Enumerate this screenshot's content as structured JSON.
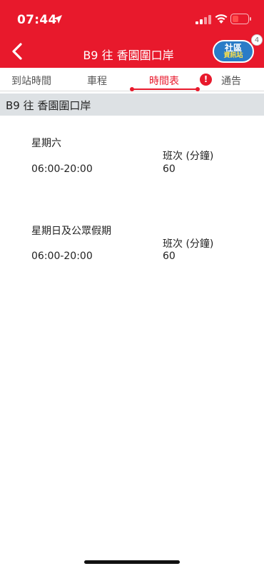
{
  "status_bar": {
    "time": "07:44"
  },
  "nav": {
    "title": "B9 往 香園圍口岸",
    "community_line1": "社區",
    "community_line2": "資訊站",
    "badge_count": "4"
  },
  "tabs": [
    {
      "label": "到站時間",
      "active": false
    },
    {
      "label": "車程",
      "active": false
    },
    {
      "label": "時間表",
      "active": true
    },
    {
      "label": "通告",
      "active": false
    }
  ],
  "route_heading": "B9 往 香園圍口岸",
  "schedules": [
    {
      "day": "星期六",
      "freq_header": "班次 (分鐘)",
      "time_range": "06:00-20:00",
      "frequency": "60"
    },
    {
      "day": "星期日及公眾假期",
      "freq_header": "班次 (分鐘)",
      "time_range": "06:00-20:00",
      "frequency": "60"
    }
  ],
  "colors": {
    "brand_red": "#e8192c",
    "section_bg": "#dde1e4",
    "community_blue": "#2a7cc7"
  }
}
